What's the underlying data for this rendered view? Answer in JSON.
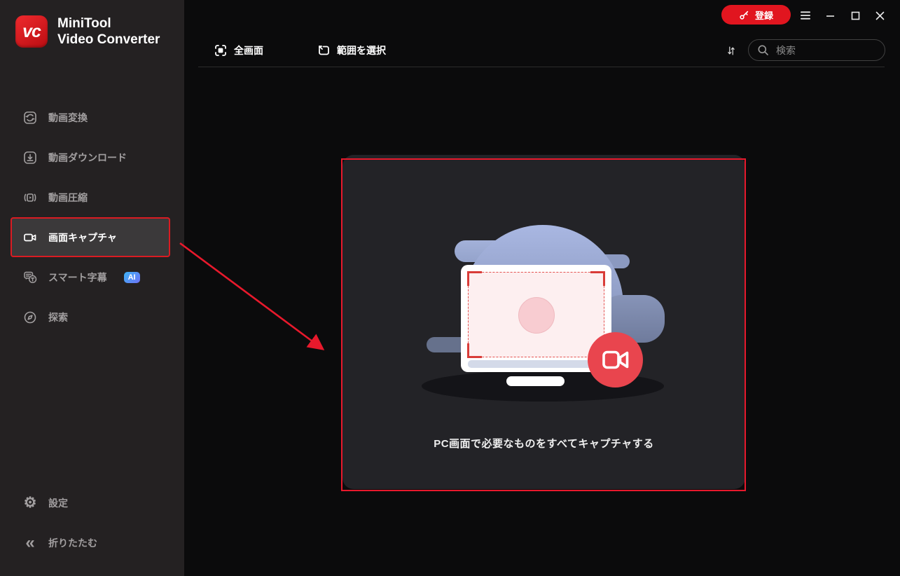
{
  "app": {
    "logo_text": "vc",
    "brand_line1": "MiniTool",
    "brand_line2": "Video Converter"
  },
  "titlebar": {
    "register_label": "登録"
  },
  "sidebar": {
    "items": [
      {
        "label": "動画変換",
        "icon": "convert-icon"
      },
      {
        "label": "動画ダウンロード",
        "icon": "download-icon"
      },
      {
        "label": "動画圧縮",
        "icon": "compress-icon"
      },
      {
        "label": "画面キャプチャ",
        "icon": "capture-icon",
        "selected": true
      },
      {
        "label": "スマート字幕",
        "icon": "subtitle-icon",
        "badge": "AI"
      },
      {
        "label": "探索",
        "icon": "explore-icon"
      }
    ],
    "footer_items": [
      {
        "label": "設定",
        "icon": "gear-icon"
      },
      {
        "label": "折りたたむ",
        "icon": "collapse-icon"
      }
    ]
  },
  "toolbar": {
    "fullscreen_label": "全画面",
    "region_label": "範囲を選択",
    "search_placeholder": "検索"
  },
  "main": {
    "caption": "PC画面で必要なものをすべてキャプチャする"
  },
  "colors": {
    "accent_red": "#e8192c",
    "register_red": "#e1151f",
    "sidebar_bg": "#242122",
    "content_bg": "#0b0b0c",
    "card_bg": "#232327",
    "selected_item_bg": "#3b393a",
    "ai_badge_gradient": [
      "#3db4f7",
      "#6e72f5"
    ],
    "illustration_blue": "#a9b7e2",
    "record_red": "#e9454e"
  }
}
